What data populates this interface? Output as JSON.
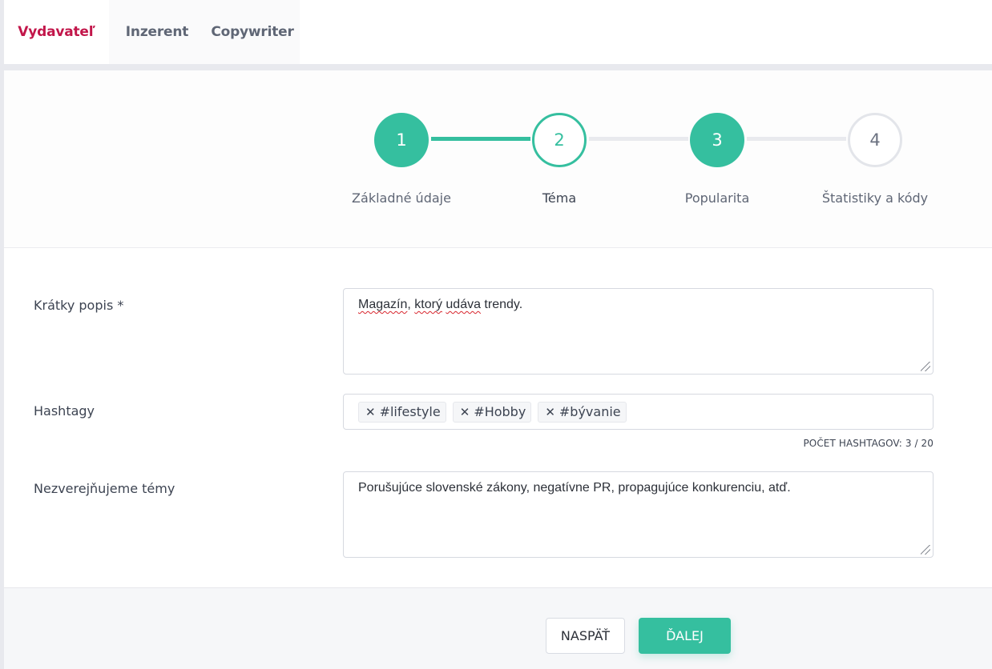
{
  "tabs": [
    {
      "label": "Vydavateľ",
      "active": true
    },
    {
      "label": "Inzerent",
      "active": false
    },
    {
      "label": "Copywriter",
      "active": false
    }
  ],
  "stepper": {
    "steps": [
      {
        "number": "1",
        "label": "Základné údaje",
        "state": "completed"
      },
      {
        "number": "2",
        "label": "Téma",
        "state": "current"
      },
      {
        "number": "3",
        "label": "Popularita",
        "state": "completed"
      },
      {
        "number": "4",
        "label": "Štatistiky a kódy",
        "state": "pending"
      }
    ]
  },
  "form": {
    "short_description": {
      "label": "Krátky popis *",
      "value_words": [
        "Magazín",
        ", ",
        "ktorý",
        " ",
        "udáva",
        " trendy."
      ]
    },
    "hashtags": {
      "label": "Hashtagy",
      "tags": [
        "#lifestyle",
        "#Hobby",
        "#bývanie"
      ],
      "remove_icon": "✕",
      "counter": "POČET HASHTAGOV: 3 / 20"
    },
    "excluded_topics": {
      "label": "Nezverejňujeme témy",
      "value": "Porušujúce slovenské zákony, negatívne PR, propagujúce konkurenciu, atď."
    }
  },
  "footer": {
    "back_label": "NASPÄŤ",
    "next_label": "ĎALEJ"
  },
  "colors": {
    "accent": "#35bf9f",
    "active_tab": "#c2164a"
  }
}
